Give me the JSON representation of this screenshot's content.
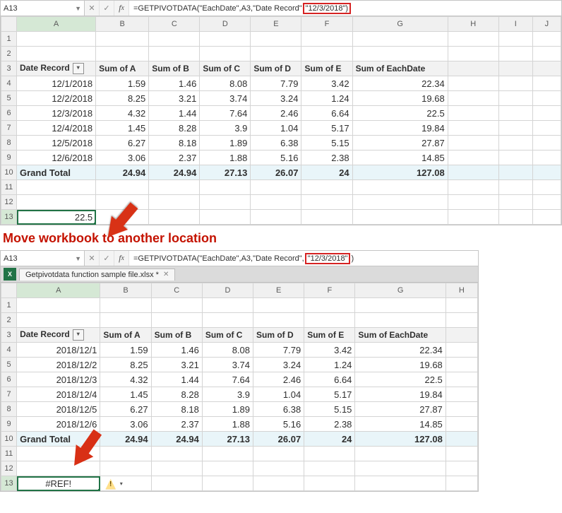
{
  "top": {
    "cell_ref": "A13",
    "formula_prefix": "=GETPIVOTDATA(\"EachDate\",A3,\"Date Record\"",
    "formula_hl": "\"12/3/2018\")",
    "cols": [
      "A",
      "B",
      "C",
      "D",
      "E",
      "F",
      "G",
      "H",
      "I",
      "J"
    ],
    "headers": [
      "Date Record",
      "Sum of A",
      "Sum of B",
      "Sum of C",
      "Sum of D",
      "Sum of E",
      "Sum of EachDate"
    ],
    "rows": [
      {
        "n": 4,
        "c": [
          "12/1/2018",
          "1.59",
          "1.46",
          "8.08",
          "7.79",
          "3.42",
          "22.34"
        ]
      },
      {
        "n": 5,
        "c": [
          "12/2/2018",
          "8.25",
          "3.21",
          "3.74",
          "3.24",
          "1.24",
          "19.68"
        ]
      },
      {
        "n": 6,
        "c": [
          "12/3/2018",
          "4.32",
          "1.44",
          "7.64",
          "2.46",
          "6.64",
          "22.5"
        ]
      },
      {
        "n": 7,
        "c": [
          "12/4/2018",
          "1.45",
          "8.28",
          "3.9",
          "1.04",
          "5.17",
          "19.84"
        ]
      },
      {
        "n": 8,
        "c": [
          "12/5/2018",
          "6.27",
          "8.18",
          "1.89",
          "6.38",
          "5.15",
          "27.87"
        ]
      },
      {
        "n": 9,
        "c": [
          "12/6/2018",
          "3.06",
          "2.37",
          "1.88",
          "5.16",
          "2.38",
          "14.85"
        ]
      }
    ],
    "total_label": "Grand Total",
    "totals": [
      "24.94",
      "24.94",
      "27.13",
      "26.07",
      "24",
      "127.08"
    ],
    "sel_value": "22.5"
  },
  "caption": "Move workbook to another location",
  "bottom": {
    "cell_ref": "A13",
    "formula_prefix": "=GETPIVOTDATA(\"EachDate\",A3,\"Date Record\",",
    "formula_hl": "\"12/3/2018\"",
    "formula_suffix": ")",
    "doc_name": "Getpivotdata function sample file.xlsx *",
    "cols": [
      "A",
      "B",
      "C",
      "D",
      "E",
      "F",
      "G",
      "H"
    ],
    "headers": [
      "Date Record",
      "Sum of A",
      "Sum of B",
      "Sum of C",
      "Sum of D",
      "Sum of E",
      "Sum of EachDate"
    ],
    "rows": [
      {
        "n": 4,
        "c": [
          "2018/12/1",
          "1.59",
          "1.46",
          "8.08",
          "7.79",
          "3.42",
          "22.34"
        ]
      },
      {
        "n": 5,
        "c": [
          "2018/12/2",
          "8.25",
          "3.21",
          "3.74",
          "3.24",
          "1.24",
          "19.68"
        ]
      },
      {
        "n": 6,
        "c": [
          "2018/12/3",
          "4.32",
          "1.44",
          "7.64",
          "2.46",
          "6.64",
          "22.5"
        ]
      },
      {
        "n": 7,
        "c": [
          "2018/12/4",
          "1.45",
          "8.28",
          "3.9",
          "1.04",
          "5.17",
          "19.84"
        ]
      },
      {
        "n": 8,
        "c": [
          "2018/12/5",
          "6.27",
          "8.18",
          "1.89",
          "6.38",
          "5.15",
          "27.87"
        ]
      },
      {
        "n": 9,
        "c": [
          "2018/12/6",
          "3.06",
          "2.37",
          "1.88",
          "5.16",
          "2.38",
          "14.85"
        ]
      }
    ],
    "total_label": "Grand Total",
    "totals": [
      "24.94",
      "24.94",
      "27.13",
      "26.07",
      "24",
      "127.08"
    ],
    "sel_value": "#REF!"
  }
}
